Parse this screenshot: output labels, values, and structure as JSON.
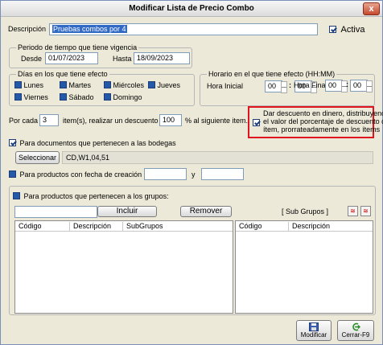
{
  "window": {
    "title": "Modificar Lista de Precio Combo",
    "close_label": "x"
  },
  "descripcion": {
    "label": "Descripción",
    "value": "Pruebas combos por 4"
  },
  "activa": {
    "label": "Activa",
    "checked": true
  },
  "periodo": {
    "legend": "Periodo de tiempo que tiene vigencia",
    "desde_label": "Desde",
    "desde_value": "01/07/2023",
    "hasta_label": "Hasta",
    "hasta_value": "18/09/2023"
  },
  "dias": {
    "legend": "Días en los que tiene efecto",
    "items": [
      {
        "label": "Lunes",
        "checked": true
      },
      {
        "label": "Martes",
        "checked": true
      },
      {
        "label": "Miércoles",
        "checked": true
      },
      {
        "label": "Jueves",
        "checked": true
      },
      {
        "label": "Viernes",
        "checked": true
      },
      {
        "label": "Sábado",
        "checked": true
      },
      {
        "label": "Domingo",
        "checked": true
      }
    ]
  },
  "horario": {
    "legend": "Horario en el que tiene efecto   (HH:MM)",
    "inicial_label": "Hora Inicial",
    "inicial_h": "00",
    "inicial_m": "00",
    "final_label": "Hora Final",
    "final_h": "00",
    "final_m": "00",
    "sep": ":"
  },
  "descuento": {
    "prefix": "Por cada",
    "cada_value": "3",
    "middle": "item(s), realizar un descuento  del",
    "pct_value": "100",
    "suffix": "% al siguiente item."
  },
  "dinero": {
    "line1": "Dar descuento en dinero, distribuyendo",
    "line2": "el valor del porcentaje de descuento del",
    "line3": "ítem, prorrateadamente en los ítems",
    "checked": true
  },
  "bodegas": {
    "label": "Para documentos que pertenecen a las bodegas",
    "checked": true,
    "select_label": "Seleccionar",
    "value": "CD,W1,04,51"
  },
  "fecha_creacion": {
    "label": "Para productos con fecha de creación entre",
    "and_label": "y",
    "from_value": "",
    "to_value": "",
    "checked": true
  },
  "grupos": {
    "label": "Para productos que pertenecen a los grupos:",
    "checked": true,
    "input_value": "",
    "include_label": "Incluir",
    "remove_label": "Remover",
    "subgrupos_label": "[ Sub Grupos ]",
    "left_columns": [
      "Código",
      "Descripción",
      "SubGrupos"
    ],
    "right_columns": [
      "Código",
      "Descripción"
    ]
  },
  "footer": {
    "modify_label": "Modificar",
    "close_label": "Cerrar-F9"
  },
  "colors": {
    "highlight": "#e0141e",
    "selection": "#316ac5"
  }
}
